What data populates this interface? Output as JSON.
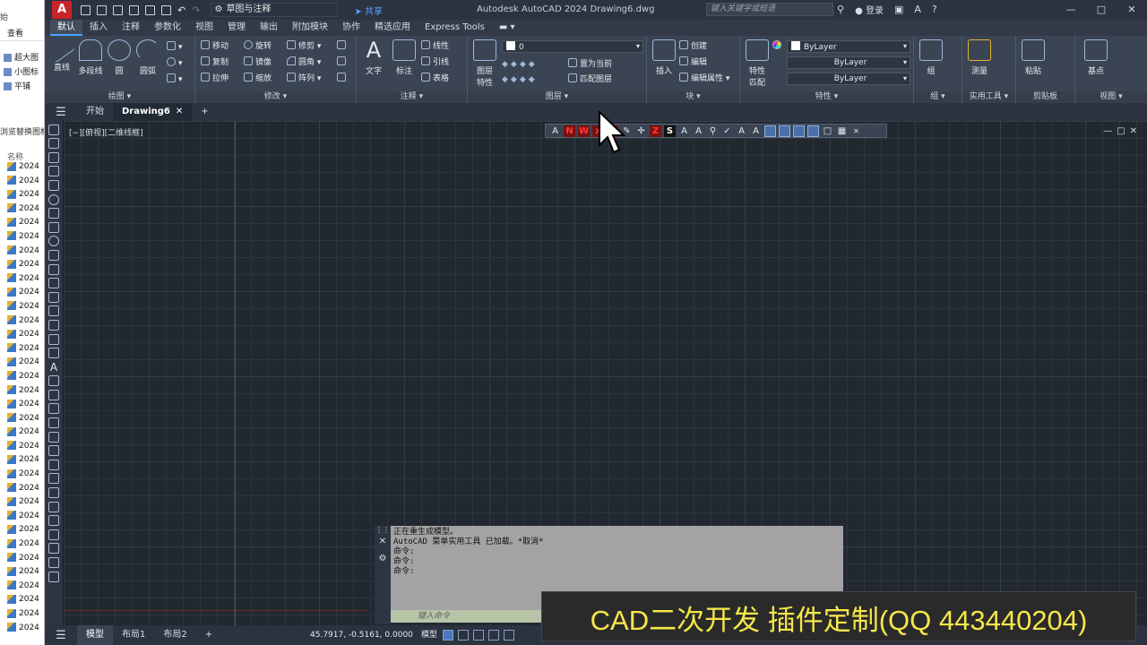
{
  "explorer": {
    "top_label": "始",
    "tab_view": "查看",
    "options": [
      "超大图",
      "小图标",
      "平铺"
    ],
    "convert_label": "浏览替换图框插",
    "name_header": "名称",
    "files": [
      "2024",
      "2024",
      "2024",
      "2024",
      "2024",
      "2024",
      "2024",
      "2024",
      "2024",
      "2024",
      "2024",
      "2024",
      "2024",
      "2024",
      "2024",
      "2024",
      "2024",
      "2024",
      "2024",
      "2024",
      "2024",
      "2024",
      "2024",
      "2024",
      "2024",
      "2024",
      "2024",
      "2024",
      "2024",
      "2024",
      "2024",
      "2024",
      "2024",
      "2024"
    ]
  },
  "titlebar": {
    "logo": "A",
    "workspace": "草图与注释",
    "share": "共享",
    "app_title": "Autodesk AutoCAD 2024    Drawing6.dwg",
    "search_placeholder": "键入关键字或短语",
    "login": "登录"
  },
  "ribbon_tabs": [
    "默认",
    "插入",
    "注释",
    "参数化",
    "视图",
    "管理",
    "输出",
    "附加模块",
    "协作",
    "精选应用",
    "Express Tools"
  ],
  "ribbon": {
    "draw": {
      "title": "绘图",
      "line": "直线",
      "polyline": "多段线",
      "circle": "圆",
      "arc": "圆弧"
    },
    "modify": {
      "title": "修改",
      "move": "移动",
      "rotate": "旋转",
      "trim": "修剪",
      "copy": "复制",
      "mirror": "镜像",
      "fillet": "圆角",
      "stretch": "拉伸",
      "scale": "缩放",
      "array": "阵列"
    },
    "annotation": {
      "title": "注释",
      "text": "文字",
      "dimension": "标注",
      "linear": "线性",
      "leader": "引线",
      "table": "表格"
    },
    "layers": {
      "title": "图层",
      "layer_props": "图层\n特性",
      "current_layer": "0",
      "set_current": "置为当前",
      "match_layer": "匹配图层"
    },
    "block": {
      "title": "块",
      "insert": "插入",
      "create": "创建",
      "edit": "编辑",
      "edit_attr": "编辑属性"
    },
    "properties": {
      "title": "特性",
      "match": "特性\n匹配",
      "color": "ByLayer",
      "linetype": "ByLayer",
      "lineweight": "ByLayer"
    },
    "groups": {
      "title": "组",
      "group": "组"
    },
    "utilities": {
      "title": "实用工具",
      "measure": "测量"
    },
    "clipboard": {
      "title": "剪贴板",
      "paste": "粘贴"
    },
    "view": {
      "title": "视图",
      "base": "基点"
    }
  },
  "file_tabs": {
    "start": "开始",
    "drawing": "Drawing6"
  },
  "viewport": {
    "label": "[−][俯视][二维线框]"
  },
  "command": {
    "history": [
      "正在重生成模型。",
      "AutoCAD 菜单实用工具 已加载。*取消*",
      "命令:",
      "命令:",
      "命令:"
    ],
    "input_placeholder": "键入命令"
  },
  "status": {
    "layout_tabs": [
      "模型",
      "布局1",
      "布局2"
    ],
    "coords": "45.7917, -0.5161, 0.0000",
    "mode": "模型"
  },
  "banner": {
    "text": "CAD二次开发 插件定制(QQ 443440204)"
  },
  "colors": {
    "accent": "#4aa3ff",
    "logo": "#c8242a",
    "banner_text": "#f6e74a"
  }
}
